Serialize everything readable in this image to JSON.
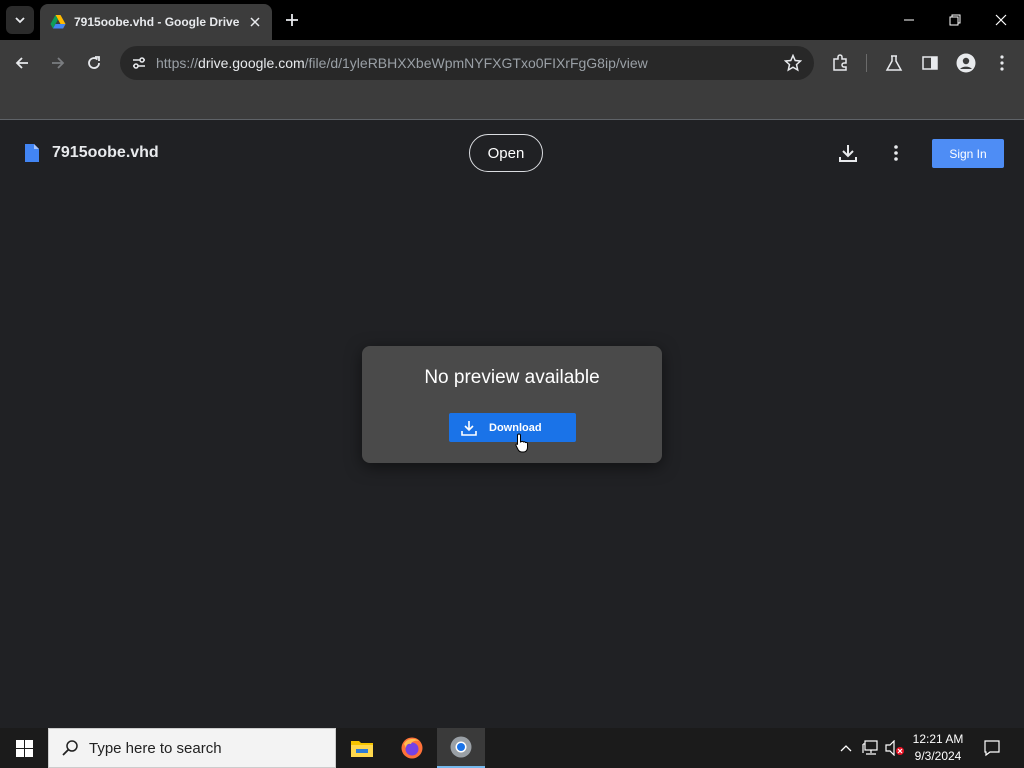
{
  "browser": {
    "tab": {
      "title": "7915oobe.vhd - Google Drive"
    },
    "url": {
      "scheme": "https://",
      "host": "drive.google.com",
      "path": "/file/d/1yleRBHXXbeWpmNYFXGTxo0FIXrFgG8ip/view"
    }
  },
  "viewer": {
    "file_name": "7915oobe.vhd",
    "open_label": "Open",
    "signin_label": "Sign In",
    "preview_message": "No preview available",
    "download_label": "Download"
  },
  "taskbar": {
    "search_placeholder": "Type here to search",
    "time": "12:21 AM",
    "date": "9/3/2024"
  },
  "colors": {
    "accent_blue": "#1a73e8",
    "signin_blue": "#4e8df5",
    "page_bg": "#202124",
    "card_bg": "#4a4a4a"
  },
  "icons": [
    "chevron-down-icon",
    "drive-icon",
    "close-icon",
    "plus-icon",
    "minimize-icon",
    "restore-icon",
    "back-icon",
    "forward-icon",
    "reload-icon",
    "tune-icon",
    "star-icon",
    "extensions-icon",
    "labs-icon",
    "sidepanel-icon",
    "profile-icon",
    "more-vert-icon",
    "file-icon",
    "download-icon",
    "windows-icon",
    "search-icon",
    "file-explorer-icon",
    "firefox-icon",
    "chrome-icon",
    "chevron-up-icon",
    "network-icon",
    "volume-muted-icon",
    "notification-icon"
  ]
}
